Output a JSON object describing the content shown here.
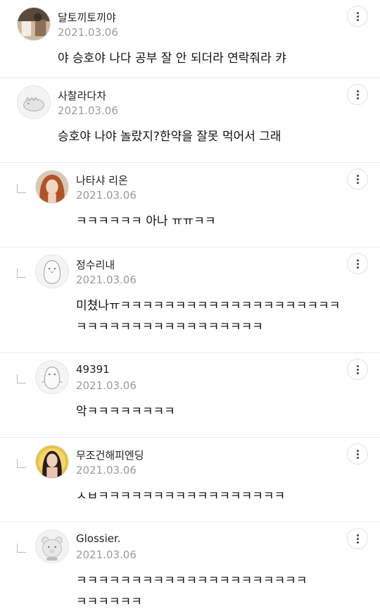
{
  "comments": [
    {
      "name": "달토끼토끼야",
      "date": "2021.03.06",
      "lines": [
        "야 승호야 나다 공부 잘 안 되더라 연락줘라 캬"
      ],
      "reply": false,
      "avatar": "photo-avatar"
    },
    {
      "name": "사찰라다차",
      "date": "2021.03.06",
      "lines": [
        "승호야 나야 놀랐지?한약을 잘못 먹어서 그래"
      ],
      "reply": false,
      "avatar": "dino-avatar"
    },
    {
      "name": "나타샤 리온",
      "date": "2021.03.06",
      "lines": [
        "ㅋㅋㅋㅋㅋㅋ 아나 ㅠㅠㅋㅋ"
      ],
      "reply": true,
      "avatar": "photo-avatar"
    },
    {
      "name": "정수리내",
      "date": "2021.03.06",
      "lines": [
        "미쳤나ㅠㅋㅋㅋㅋㅋㅋㅋㅋㅋㅋㅋㅋㅋㅋㅋㅋㅋㅋㅋㅋ",
        "ㅋㅋㅋㅋㅋㅋㅋㅋㅋㅋㅋㅋㅋㅋㅋㅋㅋ"
      ],
      "reply": true,
      "avatar": "penguin-avatar"
    },
    {
      "name": "49391",
      "date": "2021.03.06",
      "lines": [
        "악ㅋㅋㅋㅋㅋㅋㅋㅋ"
      ],
      "reply": true,
      "avatar": "penguin-avatar"
    },
    {
      "name": "무조건해피엔딩",
      "date": "2021.03.06",
      "lines": [
        "ㅅㅂㅋㅋㅋㅋㅋㅋㅋㅋㅋㅋㅋㅋㅋㅋㅋㅋㅋ"
      ],
      "reply": true,
      "avatar": "photo-avatar"
    },
    {
      "name": "Glossier.",
      "date": "2021.03.06",
      "lines": [
        "ㅋㅋㅋㅋㅋㅋㅋㅋㅋㅋㅋㅋㅋㅋㅋㅋㅋㅋㅋㅋㅋ",
        "ㅋㅋㅋㅋㅋㅋ"
      ],
      "reply": true,
      "avatar": "bear-avatar"
    }
  ],
  "icons": {
    "more": "more-vertical-icon",
    "reply": "reply-arrow-icon"
  },
  "colors": {
    "date": "#9b9b9b",
    "divider": "#ebebeb",
    "text": "#111111"
  }
}
